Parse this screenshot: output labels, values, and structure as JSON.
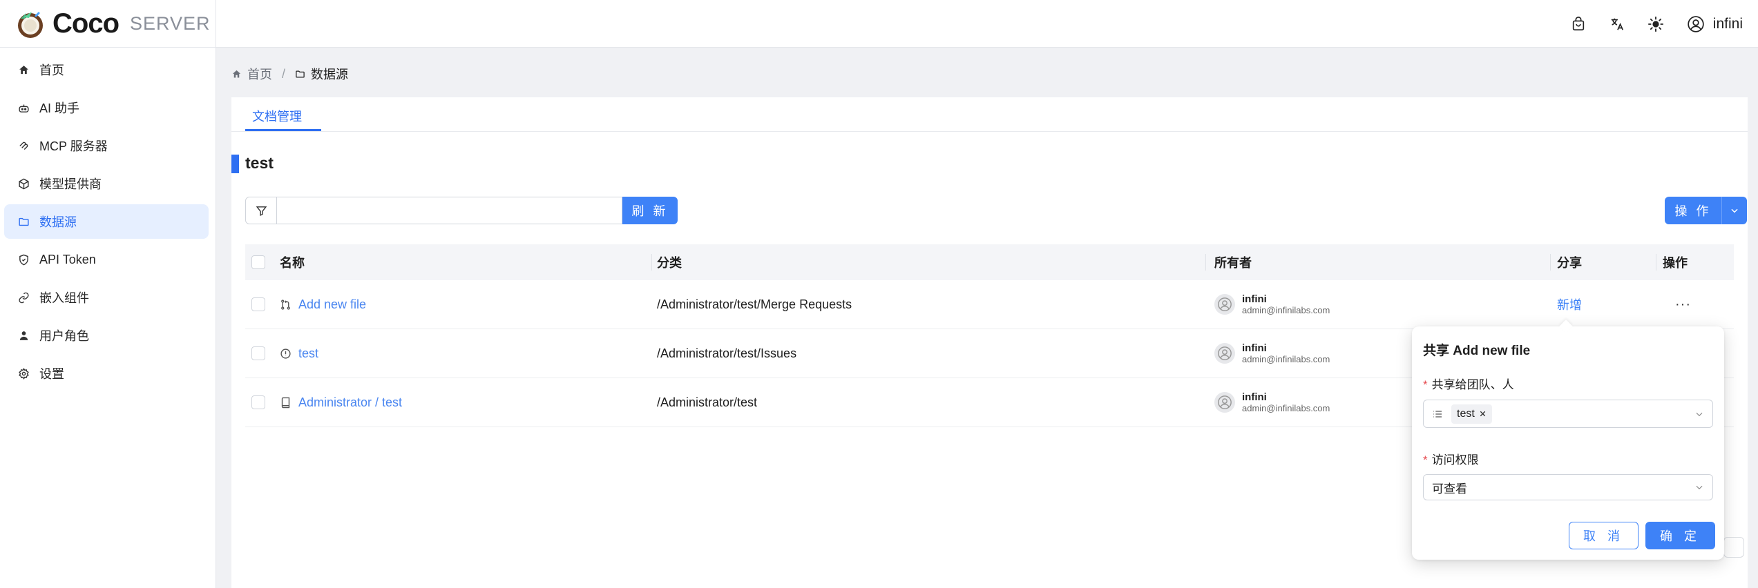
{
  "app": {
    "logo_text": "Coco",
    "logo_sub": "SERVER",
    "user_name": "infini"
  },
  "colors": {
    "accent": "#3e82f7",
    "active_nav_bg": "#e6efff",
    "link": "#4a86f0",
    "required": "#e5484d"
  },
  "topbar_icons": [
    "shopping-bag-icon",
    "translate-icon",
    "sun-icon",
    "user-circle-icon"
  ],
  "sidebar": {
    "items": [
      {
        "label": "首页",
        "icon": "home-icon"
      },
      {
        "label": "AI 助手",
        "icon": "robot-icon"
      },
      {
        "label": "MCP 服务器",
        "icon": "mcp-icon"
      },
      {
        "label": "模型提供商",
        "icon": "model-icon"
      },
      {
        "label": "数据源",
        "icon": "folder-icon",
        "active": true
      },
      {
        "label": "API Token",
        "icon": "shield-icon"
      },
      {
        "label": "嵌入组件",
        "icon": "embed-icon"
      },
      {
        "label": "用户角色",
        "icon": "user-icon"
      },
      {
        "label": "设置",
        "icon": "gear-icon"
      }
    ]
  },
  "breadcrumb": {
    "home": "首页",
    "separator": "/",
    "current": "数据源"
  },
  "tabs": [
    {
      "label": "文档管理",
      "active": true
    }
  ],
  "page_title": "test",
  "toolbar": {
    "search_value": "",
    "refresh_label": "刷 新",
    "ops_label": "操 作"
  },
  "table": {
    "columns": [
      "名称",
      "分类",
      "所有者",
      "分享",
      "操作"
    ],
    "rows": [
      {
        "name": "Add new file",
        "icon": "merge-request-icon",
        "category": "/Administrator/test/Merge Requests",
        "owner_name": "infini",
        "owner_email": "admin@infinilabs.com",
        "share": "新增",
        "actions": "···"
      },
      {
        "name": "test",
        "icon": "issue-icon",
        "category": "/Administrator/test/Issues",
        "owner_name": "infini",
        "owner_email": "admin@infinilabs.com",
        "share": "",
        "actions": ""
      },
      {
        "name": "Administrator / test",
        "icon": "repo-icon",
        "category": "/Administrator/test",
        "owner_name": "infini",
        "owner_email": "admin@infinilabs.com",
        "share": "",
        "actions": ""
      }
    ]
  },
  "share_popover": {
    "title": "共享 Add new file",
    "share_to_label": "共享给团队、人",
    "share_to_tags": [
      "test"
    ],
    "permission_label": "访问权限",
    "permission_value": "可查看",
    "cancel_label": "取 消",
    "ok_label": "确 定"
  }
}
